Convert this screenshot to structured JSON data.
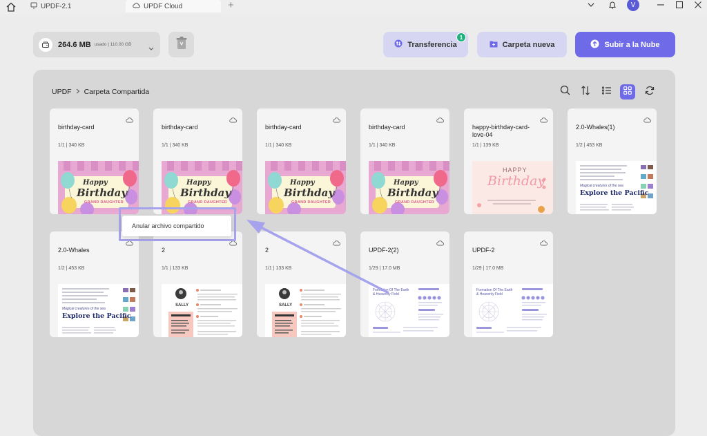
{
  "titlebar": {
    "tabs": [
      {
        "label": "UPDF-2.1"
      },
      {
        "label": "UPDF Cloud"
      }
    ],
    "avatar_initial": "V"
  },
  "storage": {
    "used": "264.6 MB",
    "detail": "usado | 110.00 GB"
  },
  "actions": {
    "transfer_label": "Transferencia",
    "transfer_badge": "1",
    "new_folder_label": "Carpeta nueva",
    "upload_label": "Subir a la Nube"
  },
  "breadcrumb": {
    "root": "UPDF",
    "current": "Carpeta Compartida"
  },
  "files": [
    {
      "name": "birthday-card",
      "meta": "1/1 | 340 KB"
    },
    {
      "name": "birthday-card",
      "meta": "1/1 | 340 KB"
    },
    {
      "name": "birthday-card",
      "meta": "1/1 | 340 KB"
    },
    {
      "name": "birthday-card",
      "meta": "1/1 | 340 KB"
    },
    {
      "name": "happy-birthday-card-love-04",
      "meta": "1/1 | 139 KB"
    },
    {
      "name": "2.0-Whales(1)",
      "meta": "1/2 | 453 KB"
    },
    {
      "name": "2.0-Whales",
      "meta": "1/2 | 453 KB"
    },
    {
      "name": "2",
      "meta": "1/1 | 133 KB"
    },
    {
      "name": "2",
      "meta": "1/1 | 133 KB"
    },
    {
      "name": "UPDF-2(2)",
      "meta": "1/29 | 17.0 MB"
    },
    {
      "name": "UPDF-2",
      "meta": "1/29 | 17.0 MB"
    }
  ],
  "thumb_text": {
    "happy": "Happy",
    "birthday": "Birthday",
    "granddaughter": "GRAND DAUGHTER",
    "happy_caps": "HAPPY",
    "birthday_script": "Birthday",
    "whales_kicker": "Magical creatures of the sea",
    "whales_title": "Explore the Pacific",
    "resume_name": "SALLY",
    "updf_title": "Formation Of The Earth & Heavenly Field"
  },
  "context_menu": {
    "item": "Anular archivo compartido"
  },
  "colors": {
    "accent": "#6f6be8",
    "badge": "#22b07d"
  }
}
